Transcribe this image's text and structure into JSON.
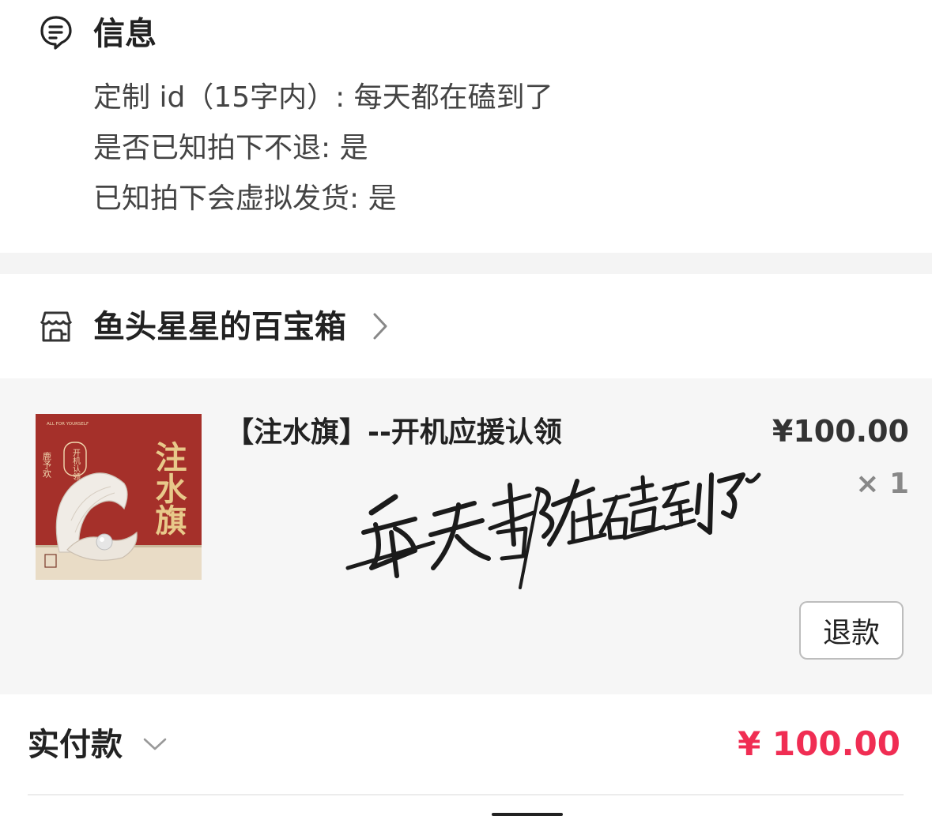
{
  "info": {
    "icon": "message-note-icon",
    "title": "信息",
    "lines": [
      "定制 id（15字内）: 每天都在磕到了",
      "是否已知拍下不退: 是",
      "已知拍下会虚拟发货: 是"
    ]
  },
  "shop": {
    "icon": "store-icon",
    "name": "鱼头星星的百宝箱"
  },
  "item": {
    "title": "【注水旗】--开机应援认领",
    "price": "¥100.00",
    "quantity": "× 1",
    "thumbnail": {
      "top_text": "ALL FOR YOURSELF",
      "badge_text": "开机认领",
      "side_text": "鹿予欢",
      "big_text": "注水旗",
      "colors": {
        "background": "#a5302a",
        "floor": "#e9dcc6",
        "gold": "#e8c98a"
      }
    },
    "signature_text": "每天都在磕到了",
    "refund_label": "退款"
  },
  "total": {
    "label": "实付款",
    "amount": "¥ 100.00",
    "amount_color": "#f02d53"
  }
}
